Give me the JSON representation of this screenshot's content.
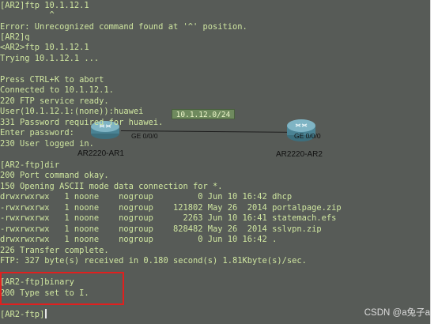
{
  "terminal": {
    "lines": [
      "[AR2]ftp 10.1.12.1",
      "          ^",
      "Error: Unrecognized command found at '^' position.",
      "[AR2]q",
      "<AR2>ftp 10.1.12.1",
      "Trying 10.1.12.1 ...",
      "",
      "Press CTRL+K to abort",
      "Connected to 10.1.12.1.",
      "220 FTP service ready.",
      "User(10.1.12.1:(none)):huawei",
      "331 Password required for huawei.",
      "Enter password:",
      "230 User logged in.",
      "",
      "[AR2-ftp]dir",
      "200 Port command okay.",
      "150 Opening ASCII mode data connection for *.",
      "drwxrwxrwx   1 noone    nogroup         0 Jun 10 16:42 dhcp",
      "-rwxrwxrwx   1 noone    nogroup    121802 May 26  2014 portalpage.zip",
      "-rwxrwxrwx   1 noone    nogroup      2263 Jun 10 16:41 statemach.efs",
      "-rwxrwxrwx   1 noone    nogroup    828482 May 26  2014 sslvpn.zip",
      "drwxrwxrwx   1 noone    nogroup         0 Jun 10 16:42 .",
      "226 Transfer complete.",
      "FTP: 327 byte(s) received in 0.180 second(s) 1.81Kbyte(s)/sec.",
      "",
      "[AR2-ftp]binary",
      "200 Type set to I.",
      "",
      "[AR2-ftp]"
    ]
  },
  "topology": {
    "subnet_label": "10.1.12.0/24",
    "router1": {
      "name": "AR2220-AR1",
      "port": "GE 0/0/0"
    },
    "router2": {
      "name": "AR2220-AR2",
      "port": "GE 0/0/0"
    }
  },
  "watermark": "CSDN @a兔子a",
  "colors": {
    "terminal_bg": "#575b57",
    "terminal_text": "#cfe6a0",
    "highlight": "#e0201f"
  }
}
